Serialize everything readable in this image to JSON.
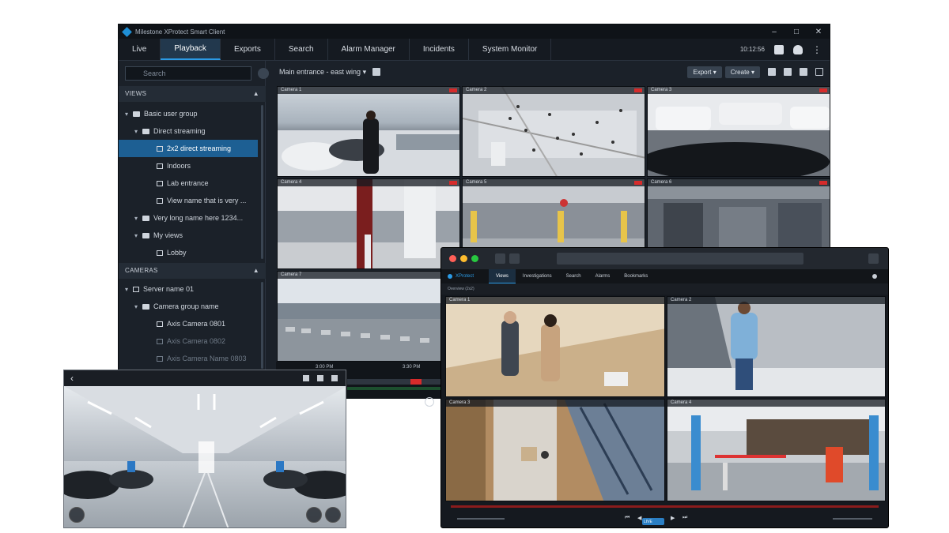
{
  "main_window": {
    "title": "Milestone XProtect Smart Client",
    "clock": "10:12:56",
    "nav_tabs": [
      "Live",
      "Playback",
      "Exports",
      "Search",
      "Alarm Manager",
      "Incidents",
      "System Monitor"
    ],
    "active_tab": "Playback",
    "search_placeholder": "Search",
    "view_selector": "Main entrance - east wing",
    "export_label": "Export",
    "create_label": "Create",
    "views_header": "VIEWS",
    "views_tree": [
      {
        "label": "Basic user group",
        "level": 0,
        "type": "folder",
        "expanded": true
      },
      {
        "label": "Direct streaming",
        "level": 1,
        "type": "folder",
        "expanded": true
      },
      {
        "label": "2x2 direct streaming",
        "level": 2,
        "type": "view",
        "selected": true
      },
      {
        "label": "Indoors",
        "level": 2,
        "type": "view"
      },
      {
        "label": "Lab entrance",
        "level": 2,
        "type": "view"
      },
      {
        "label": "View name that is very ...",
        "level": 2,
        "type": "view"
      },
      {
        "label": "Very long name here 1234...",
        "level": 1,
        "type": "folder",
        "expanded": true
      },
      {
        "label": "My views",
        "level": 1,
        "type": "folder",
        "expanded": true
      },
      {
        "label": "Lobby",
        "level": 2,
        "type": "view"
      }
    ],
    "cameras_header": "CAMERAS",
    "cameras_tree": [
      {
        "label": "Server name 01",
        "level": 0,
        "type": "server"
      },
      {
        "label": "Camera group name",
        "level": 1,
        "type": "folder"
      },
      {
        "label": "Axis Camera 0801",
        "level": 2,
        "type": "camera"
      },
      {
        "label": "Axis Camera 0802",
        "level": 2,
        "type": "camera",
        "dim": true
      },
      {
        "label": "Axis Camera Name 0803",
        "level": 2,
        "type": "camera",
        "dim": true
      }
    ],
    "camera_tiles": [
      "Camera 1",
      "Camera 2",
      "Camera 3",
      "Camera 4",
      "Camera 5",
      "Camera 6",
      "Camera 7"
    ],
    "timeline_labels": [
      "3:00 PM",
      "3:30 PM"
    ]
  },
  "mac_window": {
    "brand": "XProtect",
    "nav_tabs": [
      "Views",
      "Investigations",
      "Search",
      "Alarms",
      "Bookmarks"
    ],
    "active_tab": "Views",
    "subheader": "Overview (2x2)",
    "camera_tiles": [
      "Camera 1",
      "Camera 2",
      "Camera 3",
      "Camera 4"
    ],
    "live_label": "LIVE"
  },
  "tablet_window": {
    "icons": [
      "back-icon",
      "mic-icon",
      "speaker-icon",
      "volume-icon"
    ]
  },
  "colors": {
    "accent": "#2b9be6",
    "selected": "#1d5f93",
    "window_bg": "#1b2129",
    "record": "#d62b2b"
  }
}
